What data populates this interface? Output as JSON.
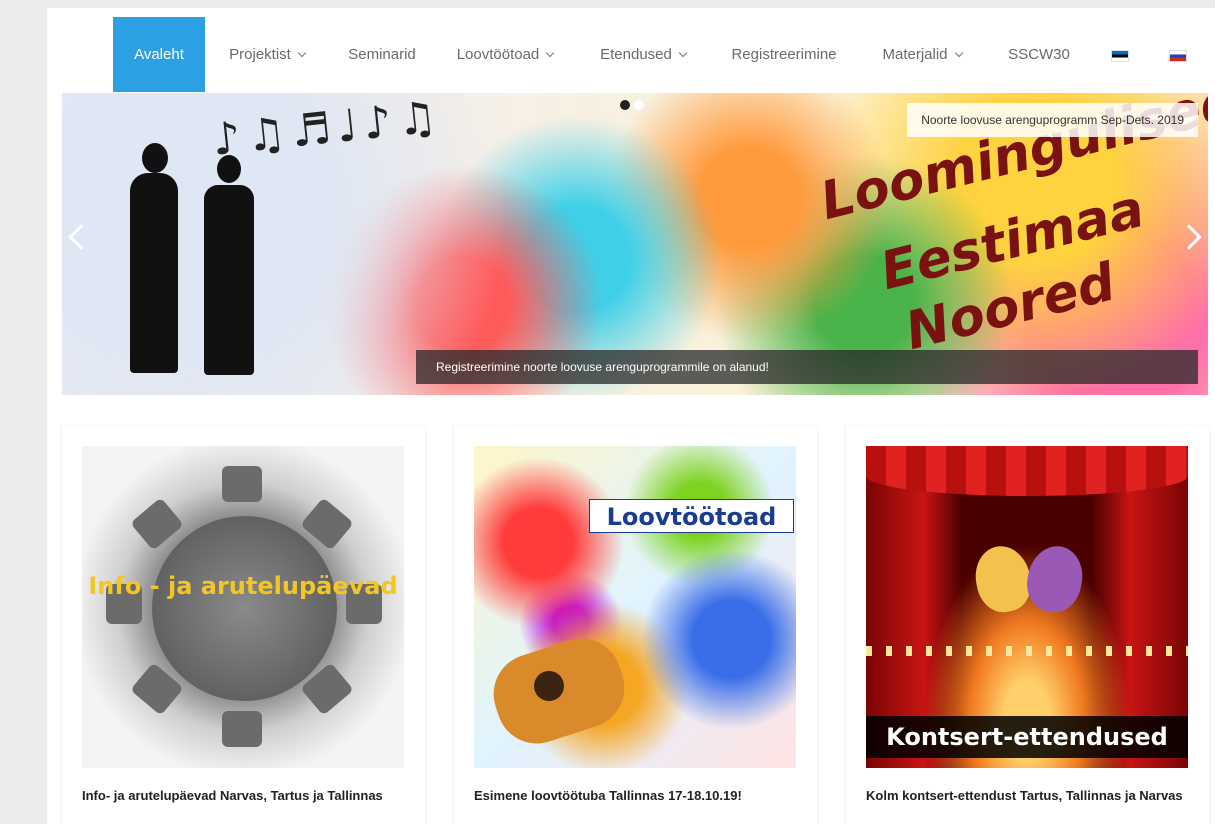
{
  "nav": {
    "items": [
      {
        "label": "Avaleht",
        "active": true,
        "dropdown": false
      },
      {
        "label": "Projektist",
        "active": false,
        "dropdown": true
      },
      {
        "label": "Seminarid",
        "active": false,
        "dropdown": false
      },
      {
        "label": "Loovtöötoad",
        "active": false,
        "dropdown": true
      },
      {
        "label": "Etendused",
        "active": false,
        "dropdown": true
      },
      {
        "label": "Registreerimine",
        "active": false,
        "dropdown": false
      },
      {
        "label": "Materjalid",
        "active": false,
        "dropdown": true
      },
      {
        "label": "SSCW30",
        "active": false,
        "dropdown": false
      }
    ],
    "flags": [
      "estonian-flag-icon",
      "russian-flag-icon"
    ],
    "accent_color": "#2d9fe3"
  },
  "slider": {
    "caption_top": "Noorte loovuse arenguprogramm Sep-Dets. 2019",
    "headline": [
      "Loomingulised",
      "Eestimaa",
      "Noored"
    ],
    "caption_bottom": "Registreerimine noorte loovuse arenguprogrammile on alanud!",
    "notes": "♪♫♬♩♪♫",
    "active_slide": 1,
    "slide_count": 2
  },
  "cards": [
    {
      "image_text": "Info - ja arutelupäevad",
      "title": "Info- ja arutelupäevad Narvas, Tartus ja Tallinnas"
    },
    {
      "image_text": "Loovtöötoad",
      "title": "Esimene loovtöötuba Tallinnas 17-18.10.19!"
    },
    {
      "image_text": "Kontsert-ettendused",
      "title": "Kolm kontsert-ettendust Tartus, Tallinnas ja Narvas"
    }
  ]
}
